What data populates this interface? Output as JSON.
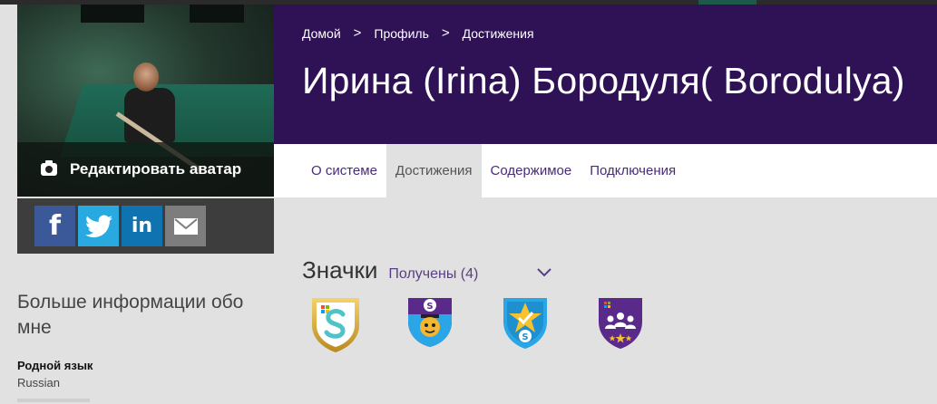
{
  "colors": {
    "header_purple": "#2f1155",
    "tab_purple": "#4a2a7a",
    "page_gray": "#e1e1e1",
    "facebook": "#3b5998",
    "twitter": "#28a9e0",
    "linkedin": "#0f73b2",
    "email": "#7d7d7d"
  },
  "breadcrumb": [
    {
      "label": "Домой"
    },
    {
      "label": "Профиль"
    },
    {
      "label": "Достижения"
    }
  ],
  "breadcrumb_separator": ">",
  "profile": {
    "name": "Ирина (Irina) Бородуля( Borodulya)"
  },
  "avatar": {
    "edit_label": "Редактировать аватар"
  },
  "share": [
    {
      "network": "facebook",
      "glyph": "f"
    },
    {
      "network": "twitter",
      "glyph": ""
    },
    {
      "network": "linkedin",
      "glyph": "in"
    },
    {
      "network": "email",
      "glyph": ""
    }
  ],
  "tabs": [
    {
      "label": "О системе",
      "active": false
    },
    {
      "label": "Достижения",
      "active": true
    },
    {
      "label": "Содержимое",
      "active": false
    },
    {
      "label": "Подключения",
      "active": false
    }
  ],
  "about": {
    "title": "Больше информации обо мне",
    "native_language_label": "Родной язык",
    "native_language_value": "Russian"
  },
  "badges": {
    "title": "Значки",
    "filter_label": "Получены (4)",
    "items": [
      {
        "icon": "microsoft-s-shield-icon"
      },
      {
        "icon": "skype-mentor-shield-icon"
      },
      {
        "icon": "skype-star-shield-icon"
      },
      {
        "icon": "microsoft-community-shield-icon"
      }
    ]
  }
}
